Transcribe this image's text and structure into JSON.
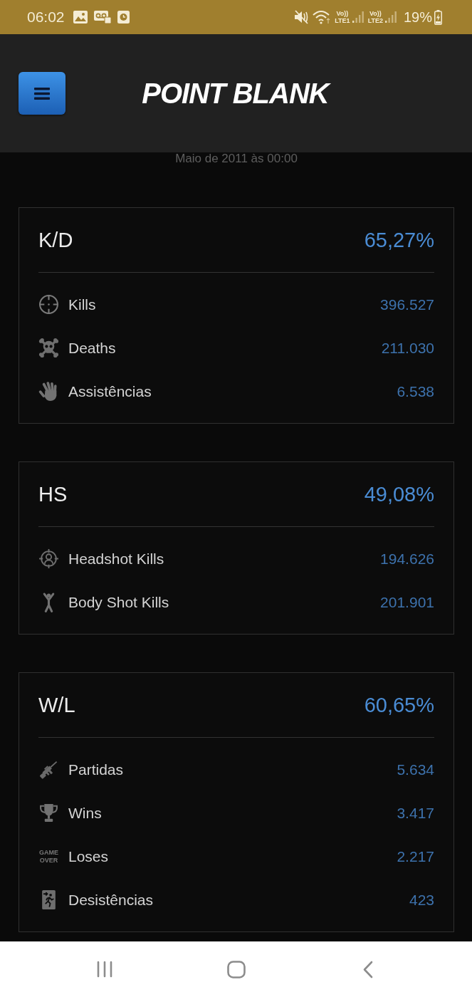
{
  "status_bar": {
    "time": "06:02",
    "networks": [
      {
        "voice": "Vo))",
        "type": "LTE1"
      },
      {
        "voice": "Vo))",
        "type": "LTE2"
      }
    ],
    "battery": "19%"
  },
  "header": {
    "logo": "POINT BLANK"
  },
  "date_line": "Maio de 2011 às 00:00",
  "stat_cards": [
    {
      "title": "K/D",
      "value": "65,27%",
      "rows": [
        {
          "label": "Kills",
          "value": "396.527"
        },
        {
          "label": "Deaths",
          "value": "211.030"
        },
        {
          "label": "Assistências",
          "value": "6.538"
        }
      ]
    },
    {
      "title": "HS",
      "value": "49,08%",
      "rows": [
        {
          "label": "Headshot Kills",
          "value": "194.626"
        },
        {
          "label": "Body Shot Kills",
          "value": "201.901"
        }
      ]
    },
    {
      "title": "W/L",
      "value": "60,65%",
      "rows": [
        {
          "label": "Partidas",
          "value": "5.634"
        },
        {
          "label": "Wins",
          "value": "3.417"
        },
        {
          "label": "Loses",
          "value": "2.217",
          "icon_text": [
            "GAME",
            "OVER"
          ]
        },
        {
          "label": "Desistências",
          "value": "423"
        }
      ]
    }
  ]
}
